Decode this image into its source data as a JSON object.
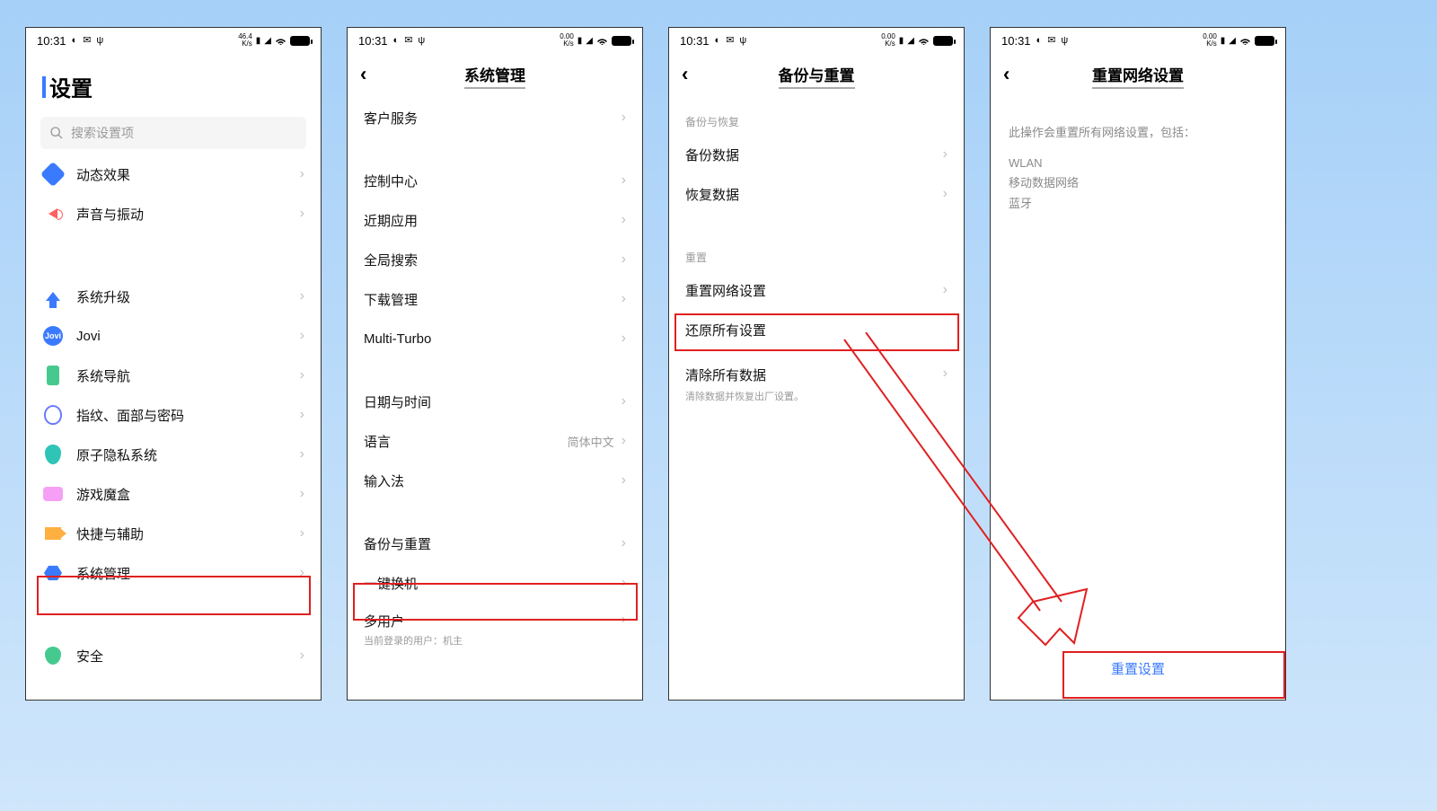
{
  "statusbar": {
    "time": "10:31"
  },
  "screen1": {
    "title": "设置",
    "search_placeholder": "搜索设置项",
    "items": {
      "dyneff": "动态效果",
      "sound": "声音与振动",
      "sysup": "系统升级",
      "jovi": "Jovi",
      "sysnav": "系统导航",
      "finger": "指纹、面部与密码",
      "atom": "原子隐私系统",
      "game": "游戏魔盒",
      "acc": "快捷与辅助",
      "sysmgr": "系统管理",
      "safety": "安全"
    }
  },
  "screen2": {
    "title": "系统管理",
    "items": {
      "cust": "客户服务",
      "ctrl": "控制中心",
      "recent": "近期应用",
      "search": "全局搜索",
      "dl": "下载管理",
      "turbo": "Multi-Turbo",
      "date": "日期与时间",
      "lang": "语言",
      "lang_val": "简体中文",
      "ime": "输入法",
      "backup": "备份与重置",
      "switch": "一键换机",
      "multi": "多用户",
      "multi_sub": "当前登录的用户：机主"
    }
  },
  "screen3": {
    "title": "备份与重置",
    "caption1": "备份与恢复",
    "items": {
      "backup": "备份数据",
      "restore": "恢复数据"
    },
    "caption2": "重置",
    "items2": {
      "netreset": "重置网络设置",
      "allreset": "还原所有设置",
      "clear": "清除所有数据",
      "clear_sub": "清除数据并恢复出厂设置。"
    }
  },
  "screen4": {
    "title": "重置网络设置",
    "desc": "此操作会重置所有网络设置，包括：",
    "lines": {
      "wlan": "WLAN",
      "data": "移动数据网络",
      "bt": "蓝牙"
    },
    "button": "重置设置"
  }
}
